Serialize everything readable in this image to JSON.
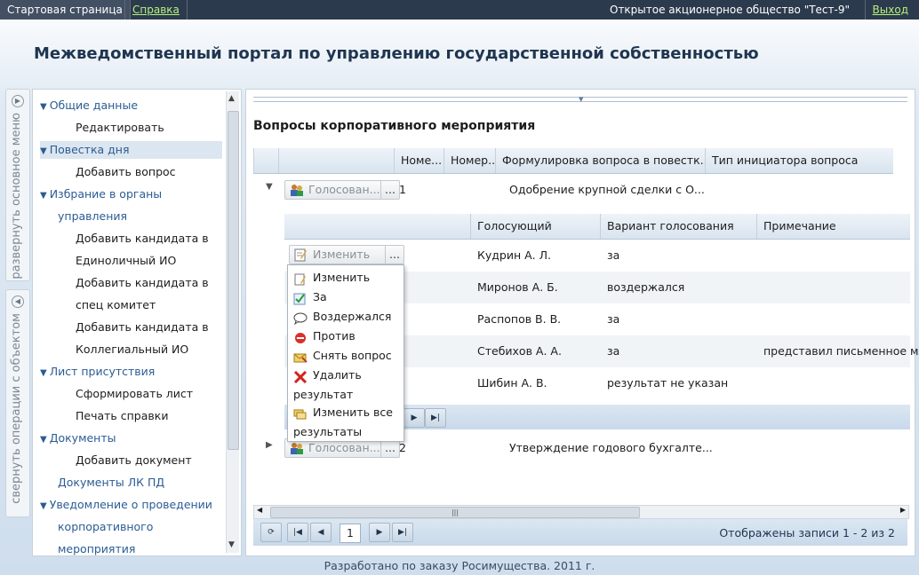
{
  "topbar": {
    "start": "Стартовая страница",
    "help": "Справка",
    "org": "Открытое акционерное общество \"Тест-9\"",
    "exit": "Выход"
  },
  "page_title": "Межведомственный портал по управлению государственной собственностью",
  "vertical_tabs": {
    "expand_menu": "развернуть основное меню",
    "collapse_ops": "свернуть операции с объектом"
  },
  "nav": [
    {
      "label": "Общие данные",
      "type": "cat"
    },
    {
      "label": "Редактировать",
      "type": "sub"
    },
    {
      "label": "Повестка дня",
      "type": "cat",
      "selected": true
    },
    {
      "label": "Добавить вопрос",
      "type": "sub"
    },
    {
      "label": "Избрание в органы",
      "type": "cat"
    },
    {
      "label": "управления",
      "type": "cont"
    },
    {
      "label": "Добавить кандидата в",
      "type": "sub"
    },
    {
      "label": "Единоличный ИО",
      "type": "sub"
    },
    {
      "label": "Добавить кандидата в",
      "type": "sub"
    },
    {
      "label": "спец комитет",
      "type": "sub"
    },
    {
      "label": "Добавить кандидата в",
      "type": "sub"
    },
    {
      "label": "Коллегиальный ИО",
      "type": "sub"
    },
    {
      "label": "Лист присутствия",
      "type": "cat"
    },
    {
      "label": "Сформировать лист",
      "type": "sub"
    },
    {
      "label": "Печать справки",
      "type": "sub"
    },
    {
      "label": "Документы",
      "type": "cat"
    },
    {
      "label": "Добавить документ",
      "type": "sub"
    },
    {
      "label": "Документы ЛК ПД",
      "type": "catnotri"
    },
    {
      "label": "Уведомление о проведении",
      "type": "cat"
    },
    {
      "label": "корпоративного",
      "type": "cont"
    },
    {
      "label": "мероприятия",
      "type": "cont"
    }
  ],
  "main": {
    "title": "Вопросы корпоративного мероприятия",
    "columns": [
      "Номе...",
      "Номер...",
      "Формулировка вопроса в повестк...",
      "Тип инициатора вопроса"
    ],
    "rows": [
      {
        "button": "Голосован...",
        "dots": "...",
        "num": "1",
        "text": "Одобрение крупной сделки с О..."
      },
      {
        "button": "Голосован...",
        "dots": "...",
        "num": "2",
        "text": "Утверждение годового бухгалте..."
      }
    ],
    "sub_columns": [
      "Голосующий",
      "Вариант голосования",
      "Примечание"
    ],
    "sub_button": "Изменить",
    "sub_rows": [
      {
        "voter": "Кудрин А. Л.",
        "option": "за",
        "note": ""
      },
      {
        "voter": "Миронов А. Б.",
        "option": "воздержался",
        "note": ""
      },
      {
        "voter": "Распопов В. В.",
        "option": "за",
        "note": ""
      },
      {
        "voter": "Стебихов А. А.",
        "option": "за",
        "note": "представил письменное мн"
      },
      {
        "voter": "Шибин А. В.",
        "option": "результат не указан",
        "note": ""
      }
    ],
    "records_info": "Отображены записи 1 - 2 из 2",
    "page_number": "1"
  },
  "menu": [
    {
      "label": "Изменить",
      "icon": "edit-icon"
    },
    {
      "label": "За",
      "icon": "check-icon"
    },
    {
      "label": "Воздержался",
      "icon": "speech-bubble-icon"
    },
    {
      "label": "Против",
      "icon": "stop-icon"
    },
    {
      "label": "Снять вопрос",
      "icon": "envelope-icon"
    },
    {
      "label": "Удалить результат",
      "icon": "delete-icon"
    },
    {
      "label": "Изменить все результаты",
      "icon": "edit-all-icon"
    }
  ],
  "footer": "Разработано по заказу Росимущества. 2011 г."
}
